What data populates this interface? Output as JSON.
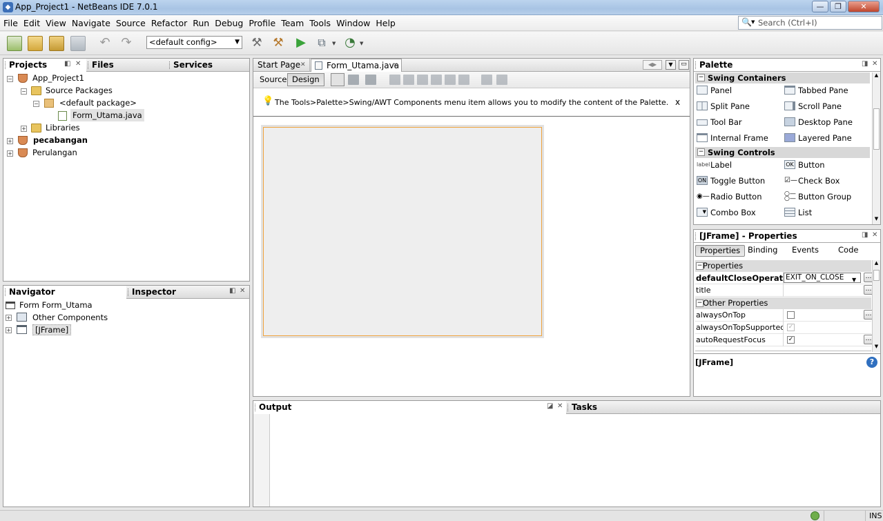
{
  "window": {
    "title": "App_Project1 - NetBeans IDE 7.0.1",
    "min": "—",
    "max": "❐",
    "close": "✕"
  },
  "menu": [
    "File",
    "Edit",
    "View",
    "Navigate",
    "Source",
    "Refactor",
    "Run",
    "Debug",
    "Profile",
    "Team",
    "Tools",
    "Window",
    "Help"
  ],
  "search": {
    "placeholder": "Search (Ctrl+I)"
  },
  "toolbar": {
    "config": "<default config>"
  },
  "projects": {
    "tabs": [
      "Projects",
      "Files",
      "Services"
    ],
    "tree": [
      {
        "label": "App_Project1",
        "bold": false
      },
      {
        "label": "Source Packages"
      },
      {
        "label": "<default package>"
      },
      {
        "label": "Form_Utama.java"
      },
      {
        "label": "Libraries"
      },
      {
        "label": "pecabangan",
        "bold": true
      },
      {
        "label": "Perulangan"
      }
    ]
  },
  "navigator": {
    "tabs": [
      "Navigator",
      "Inspector"
    ],
    "tree": [
      "Form Form_Utama",
      "Other Components",
      "[JFrame]"
    ]
  },
  "editor": {
    "tabs": [
      "Start Page",
      "Form_Utama.java"
    ],
    "modes": [
      "Source",
      "Design"
    ],
    "hint": "The Tools>Palette>Swing/AWT Components menu item allows you to modify the content of the Palette.",
    "hint_close": "x"
  },
  "palette": {
    "title": "Palette",
    "categories": [
      {
        "name": "Swing Containers",
        "items": [
          "Panel",
          "Tabbed Pane",
          "Split Pane",
          "Scroll Pane",
          "Tool Bar",
          "Desktop Pane",
          "Internal Frame",
          "Layered Pane"
        ]
      },
      {
        "name": "Swing Controls",
        "items": [
          "Label",
          "Button",
          "Toggle Button",
          "Check Box",
          "Radio Button",
          "Button Group",
          "Combo Box",
          "List"
        ]
      }
    ],
    "icon_labels": {
      "label": "label",
      "button": "OK",
      "toggle": "ON"
    }
  },
  "properties": {
    "title": "[JFrame] - Properties",
    "tabs": [
      "Properties",
      "Binding",
      "Events",
      "Code"
    ],
    "section1": "Properties",
    "defaultCloseOperation": {
      "key": "defaultCloseOperation",
      "value": "EXIT_ON_CLOSE"
    },
    "title_prop": "title",
    "section2": "Other Properties",
    "rows": [
      {
        "key": "alwaysOnTop",
        "checked": false,
        "enabled": true
      },
      {
        "key": "alwaysOnTopSupported",
        "checked": true,
        "enabled": false
      },
      {
        "key": "autoRequestFocus",
        "checked": true,
        "enabled": true
      }
    ],
    "footer": "[JFrame]",
    "help": "?"
  },
  "output": {
    "tabs": [
      "Output",
      "Tasks"
    ]
  },
  "status": {
    "mode": "INS"
  }
}
